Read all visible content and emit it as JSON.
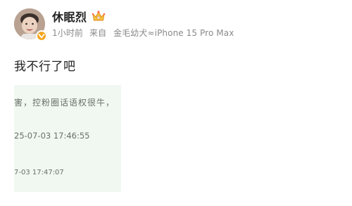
{
  "post": {
    "user_name": "休眠烈",
    "time": "1小时前",
    "source_prefix": "来自",
    "device": "金毛幼犬≈iPhone 15 Pro Max",
    "text": "我不行了吧"
  },
  "image": {
    "line1": "害，控粉圈话语权很牛，",
    "line2": "25-07-03 17:46:55",
    "line3": "7-03 17:47:07"
  },
  "icons": {
    "verified_badge": "verified-badge-icon",
    "crown": "crown-icon"
  },
  "colors": {
    "badge": "#f5a623",
    "meta_text": "#8a8a8a",
    "image_bg": "#f0f8f1"
  }
}
